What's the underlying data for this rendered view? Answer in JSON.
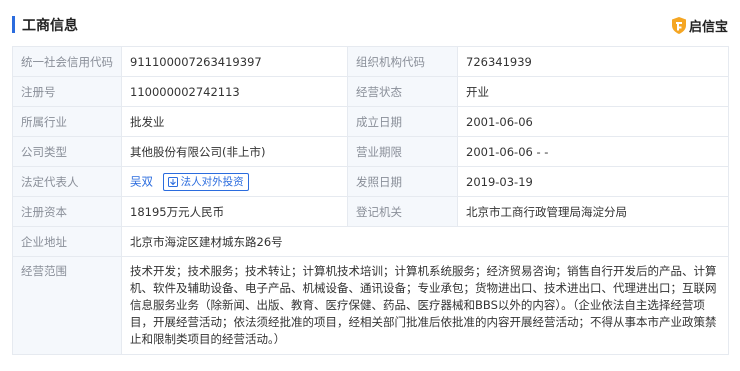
{
  "header": {
    "title": "工商信息",
    "brand": "启信宝"
  },
  "rows": {
    "credit_code": {
      "label": "统一社会信用代码",
      "value": "911100007263419397"
    },
    "org_code": {
      "label": "组织机构代码",
      "value": "726341939"
    },
    "reg_no": {
      "label": "注册号",
      "value": "110000002742113"
    },
    "status": {
      "label": "经营状态",
      "value": "开业"
    },
    "industry": {
      "label": "所属行业",
      "value": "批发业"
    },
    "founded": {
      "label": "成立日期",
      "value": "2001-06-06"
    },
    "company_type": {
      "label": "公司类型",
      "value": "其他股份有限公司(非上市)"
    },
    "term": {
      "label": "营业期限",
      "value": "2001-06-06 - -"
    },
    "legal_rep": {
      "label": "法定代表人",
      "value": "吴双",
      "button": "法人对外投资"
    },
    "issue_date": {
      "label": "发照日期",
      "value": "2019-03-19"
    },
    "capital": {
      "label": "注册资本",
      "value": "18195万元人民币"
    },
    "authority": {
      "label": "登记机关",
      "value": "北京市工商行政管理局海淀分局"
    },
    "address": {
      "label": "企业地址",
      "value": "北京市海淀区建材城东路26号"
    },
    "scope": {
      "label": "经营范围",
      "value": "技术开发；技术服务；技术转让；计算机技术培训；计算机系统服务；经济贸易咨询；销售自行开发后的产品、计算机、软件及辅助设备、电子产品、机械设备、通讯设备；专业承包；货物进出口、技术进出口、代理进出口；互联网信息服务业务（除新闻、出版、教育、医疗保健、药品、医疗器械和BBS以外的内容）。（企业依法自主选择经营项目，开展经营活动；依法须经批准的项目，经相关部门批准后依批准的内容开展经营活动；不得从事本市产业政策禁止和限制类项目的经营活动。）"
    }
  },
  "colors": {
    "accent": "#2b6cde",
    "label_bg": "#f5f8fc",
    "border": "#e6eaf0",
    "brand_icon": "#f5a623"
  },
  "icons": [
    "shield-logo-icon",
    "invest-icon"
  ]
}
